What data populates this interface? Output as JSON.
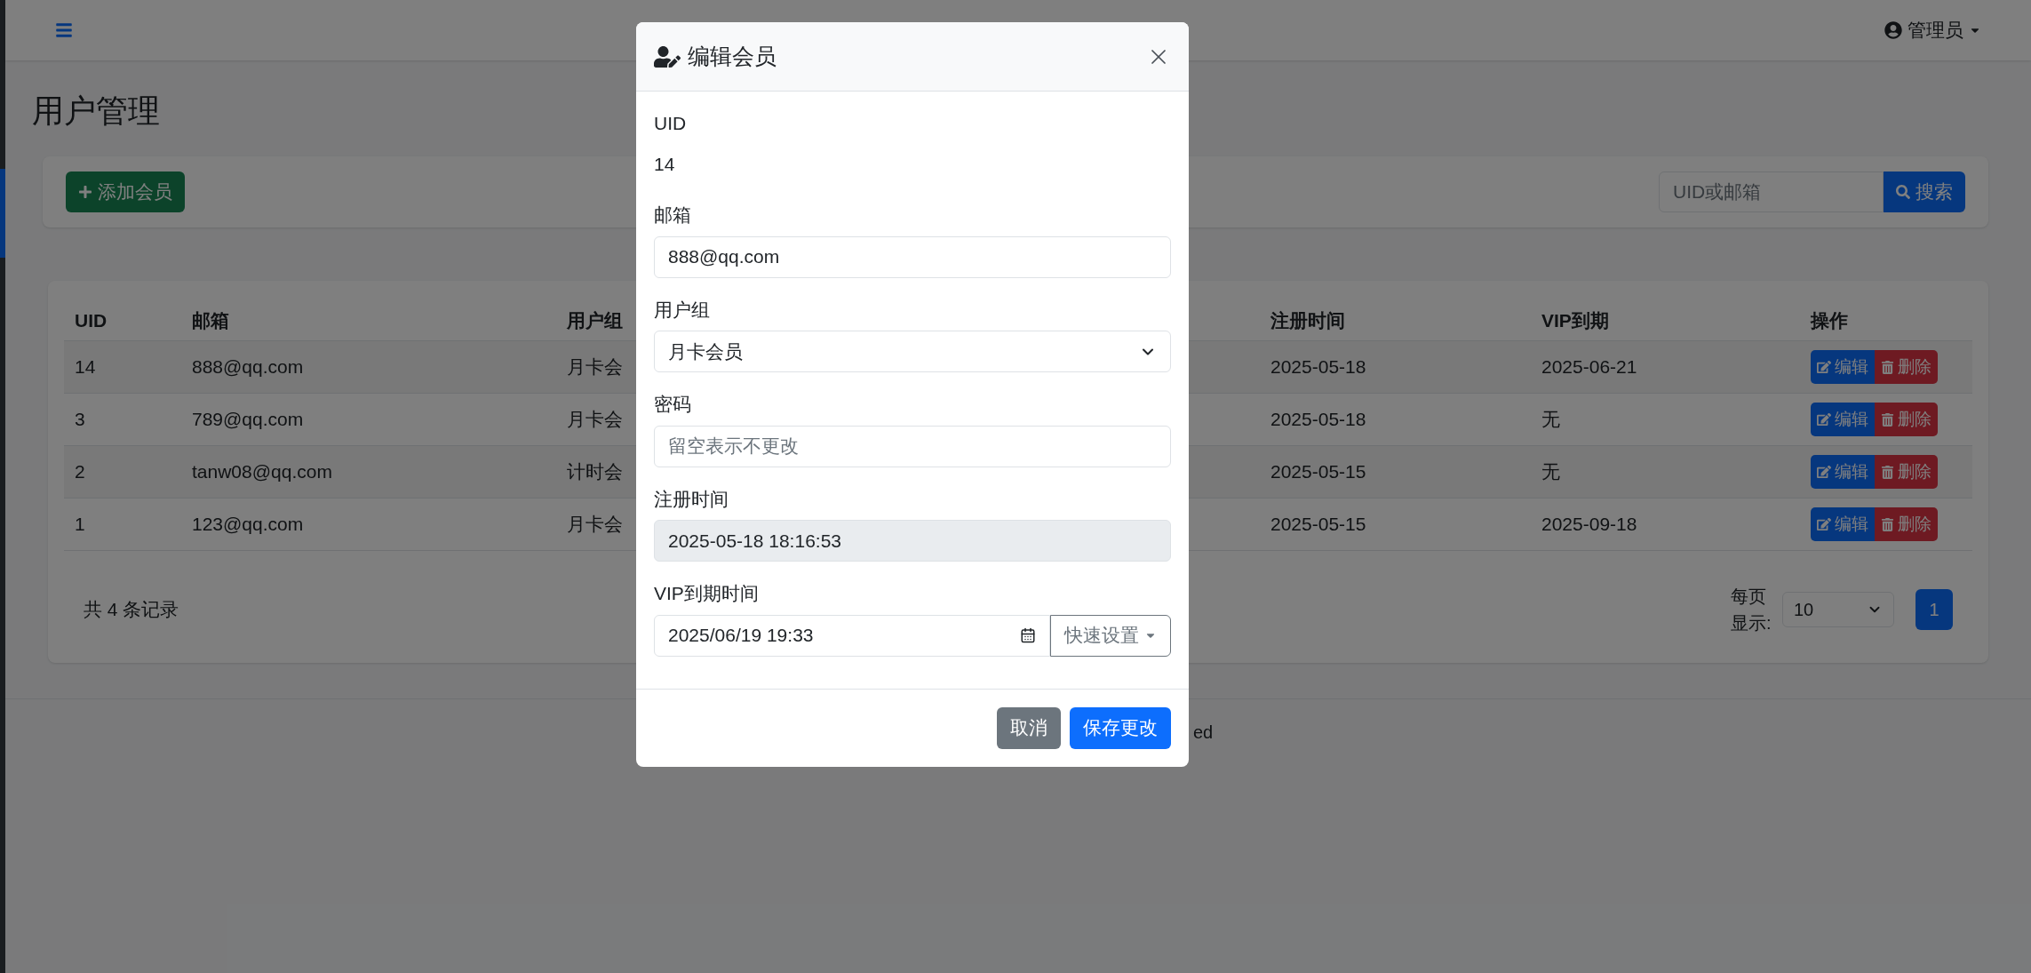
{
  "navbar": {
    "user_menu": {
      "label": "管理员"
    }
  },
  "page_title": "用户管理",
  "toolbar": {
    "add_button": "添加会员",
    "search": {
      "placeholder": "UID或邮箱",
      "button": "搜索"
    }
  },
  "table": {
    "columns": [
      "UID",
      "邮箱",
      "用户组",
      "注册时间",
      "VIP到期",
      "操作"
    ],
    "rows": [
      {
        "uid": "14",
        "email": "888@qq.com",
        "group": "月卡会",
        "registered": "2025-05-18",
        "vip_expiry": "2025-06-21",
        "actions": [
          "编辑",
          "删除"
        ]
      },
      {
        "uid": "3",
        "email": "789@qq.com",
        "group": "月卡会",
        "registered": "2025-05-18",
        "vip_expiry": "无",
        "actions": [
          "编辑",
          "删除"
        ]
      },
      {
        "uid": "2",
        "email": "tanw08@qq.com",
        "group": "计时会",
        "registered": "2025-05-15",
        "vip_expiry": "无",
        "actions": [
          "编辑",
          "删除"
        ]
      },
      {
        "uid": "1",
        "email": "123@qq.com",
        "group": "月卡会",
        "registered": "2025-05-15",
        "vip_expiry": "2025-09-18",
        "actions": [
          "编辑",
          "删除"
        ]
      }
    ]
  },
  "table_footer": {
    "total": "共 4 条记录",
    "per_page": {
      "label": "每页显示:",
      "value": "10"
    },
    "pages": [
      {
        "label": "1",
        "selected": true
      }
    ]
  },
  "page_footer": "ed",
  "modal": {
    "title": "编辑会员",
    "fields": [
      {
        "kind": "static",
        "label": "UID",
        "value": "14"
      },
      {
        "kind": "text",
        "label": "邮箱",
        "value": "888@qq.com"
      },
      {
        "kind": "select",
        "label": "用户组",
        "value": "月卡会员"
      },
      {
        "kind": "password",
        "label": "密码",
        "placeholder": "留空表示不更改"
      },
      {
        "kind": "readonly",
        "label": "注册时间",
        "value": "2025-05-18 18:16:53"
      },
      {
        "kind": "datetime",
        "label": "VIP到期时间",
        "value": "2025/06/19 19:33",
        "addon": "快速设置"
      }
    ],
    "buttons": {
      "cancel": "取消",
      "save": "保存更改"
    }
  }
}
